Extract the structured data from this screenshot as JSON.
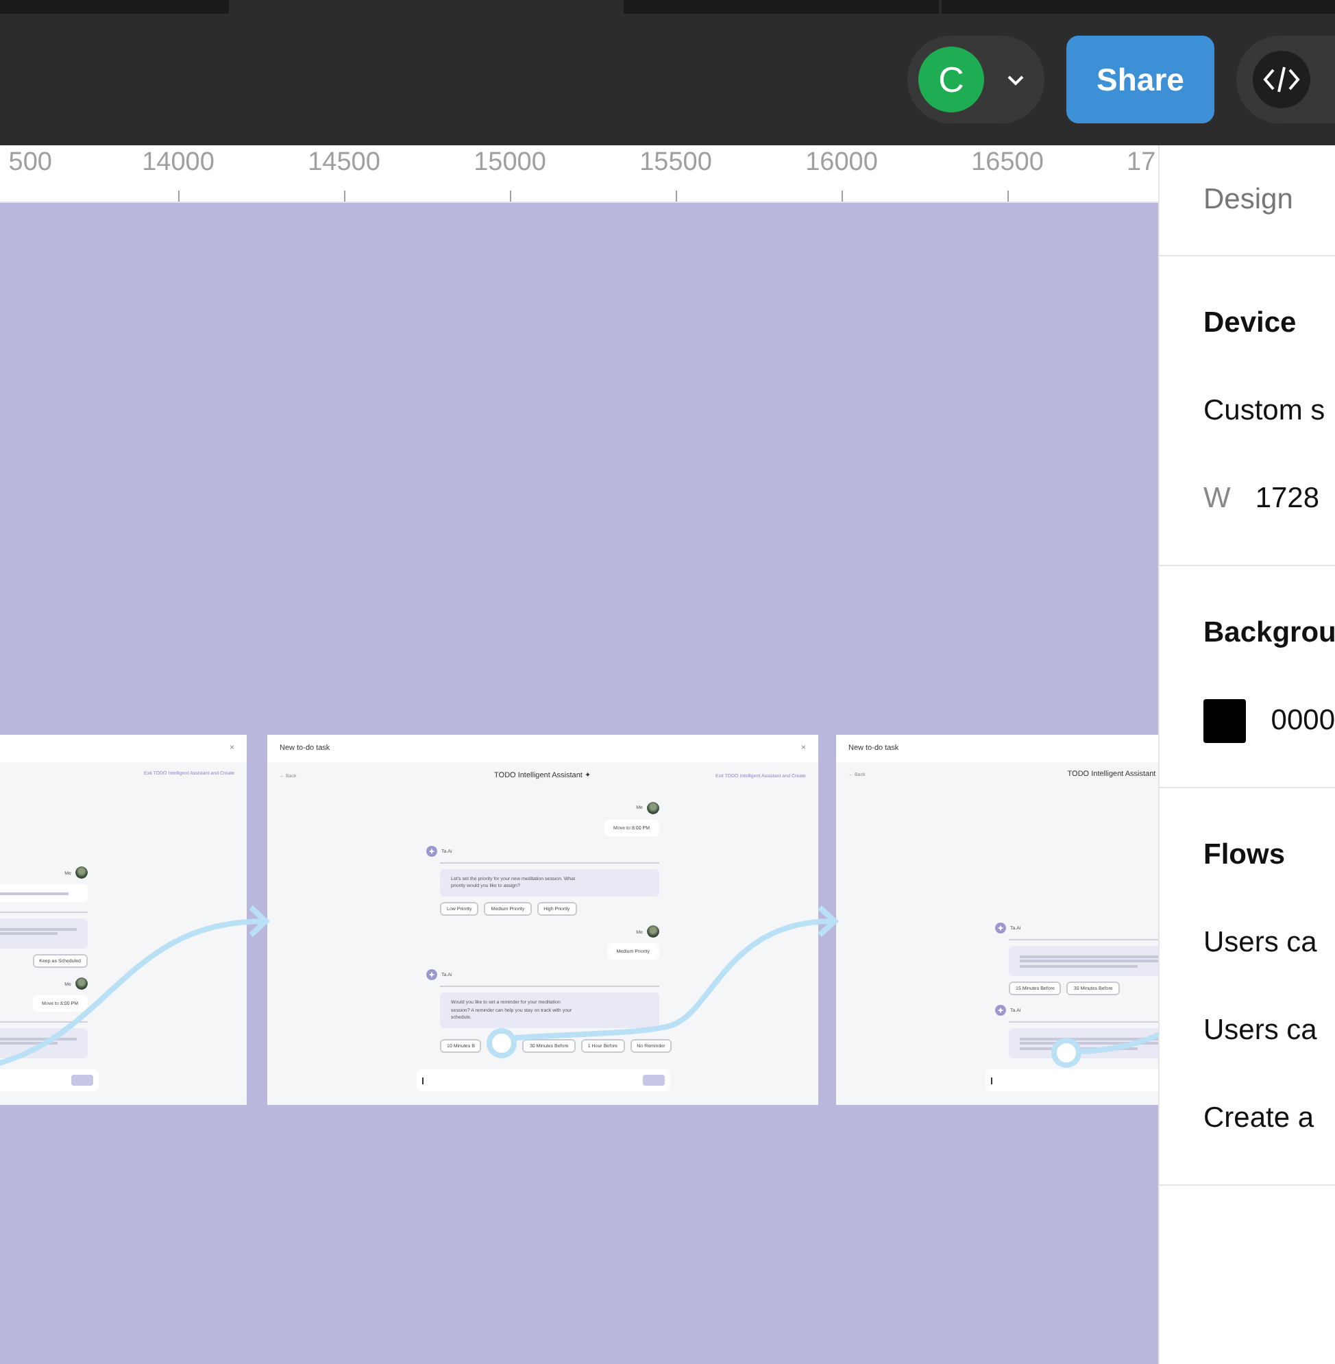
{
  "toolbar": {
    "avatar_initial": "C",
    "share_label": "Share",
    "dev_mode_on": false
  },
  "ruler": {
    "labels": [
      "500",
      "14000",
      "14500",
      "15000",
      "15500",
      "16000",
      "16500",
      "17"
    ]
  },
  "canvas": {
    "frames": [
      {
        "close": "×",
        "link": "Exit TODO Intelligent Assistant and Create",
        "messages": [
          {
            "kind": "user-hazy",
            "who": "Me"
          },
          {
            "kind": "ai-hazy",
            "options": [
              "Keep as Scheduled"
            ]
          },
          {
            "kind": "user",
            "who": "Me",
            "text": "Move to 8:00 PM"
          },
          {
            "kind": "ai-hazy"
          }
        ]
      },
      {
        "title": "New to-do task",
        "close": "×",
        "back": "← Back",
        "heading": "TODO Intelligent Assistant ✦",
        "link": "Exit TODO Intelligent Assistant and Create",
        "messages": [
          {
            "kind": "user",
            "who": "Me",
            "text": "Move to 8:00 PM"
          },
          {
            "kind": "ai",
            "who": "Ta.Ai",
            "text": "Let's set the priority for your new meditation session. What priority would you like to assign?",
            "options": [
              "Low Priority",
              "Medium Priority",
              "High Priority"
            ]
          },
          {
            "kind": "user",
            "who": "Me",
            "text": "Medium Priority"
          },
          {
            "kind": "ai",
            "who": "Ta.Ai",
            "text": "Would you like to set a reminder for your meditation session? A reminder can help you stay on track with your schedule.",
            "options": [
              "10 Minutes B",
              "30 Minutes Before",
              "1 Hour Before",
              "No Reminder"
            ]
          }
        ]
      },
      {
        "title": "New to-do task",
        "back": "← Back",
        "heading": "TODO Intelligent Assistant",
        "messages": [
          {
            "kind": "ai-hazy",
            "who": "Ta.Ai",
            "options": [
              "15 Minutes Before",
              "30 Minutes Before"
            ]
          },
          {
            "kind": "ai-hazy",
            "who": "Ta.Ai"
          }
        ]
      }
    ]
  },
  "panel": {
    "tab": "Design",
    "sections": [
      {
        "title": "Device",
        "rows": [
          {
            "kind": "text",
            "text": "Custom s"
          },
          {
            "kind": "field",
            "label": "W",
            "value": "1728"
          }
        ]
      },
      {
        "title": "Backgrou",
        "rows": [
          {
            "kind": "swatch",
            "color": "#000000",
            "value": "0000"
          }
        ]
      },
      {
        "title": "Flows",
        "rows": [
          {
            "kind": "text",
            "text": "Users ca"
          },
          {
            "kind": "text",
            "text": "Users ca"
          },
          {
            "kind": "text",
            "text": "Create a"
          }
        ]
      }
    ]
  }
}
